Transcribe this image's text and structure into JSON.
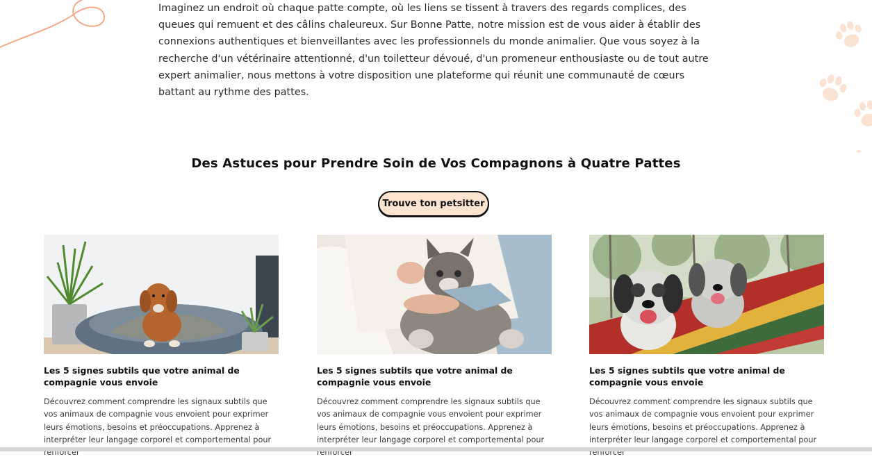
{
  "intro": {
    "text": "Imaginez un endroit où chaque patte compte, où les liens se tissent à travers des regards complices, des queues qui remuent et des câlins chaleureux. Sur Bonne Patte, notre mission est de vous aider à établir des connexions authentiques et bienveillantes avec les professionnels du monde animalier. Que vous soyez à la recherche d'un vétérinaire attentionné, d'un toiletteur dévoué, d'un promeneur enthousiaste ou de tout autre expert animalier, nous mettons à votre disposition une plateforme qui réunit une communauté de cœurs battant au rythme des pattes."
  },
  "tips": {
    "title": "Des Astuces pour Prendre Soin de Vos Compagnons à Quatre Pattes",
    "cta_label": "Trouve ton petsitter"
  },
  "cards": [
    {
      "title": "Les 5 signes subtils que votre animal de compagnie vous envoie",
      "excerpt": "Découvrez comment comprendre les signaux subtils que vos animaux de compagnie vous envoient pour exprimer leurs émotions, besoins et préoccupations. Apprenez à interpréter leur langage corporel et comportemental pour renforcer"
    },
    {
      "title": "Les 5 signes subtils que votre animal de compagnie vous envoie",
      "excerpt": "Découvrez comment comprendre les signaux subtils que vos animaux de compagnie vous envoient pour exprimer leurs émotions, besoins et préoccupations. Apprenez à interpréter leur langage corporel et comportemental pour renforcer"
    },
    {
      "title": "Les 5 signes subtils que votre animal de compagnie vous envoie",
      "excerpt": "Découvrez comment comprendre les signaux subtils que vos animaux de compagnie vous envoient pour exprimer leurs émotions, besoins et préoccupations. Apprenez à interpréter leur langage corporel et comportemental pour renforcer"
    }
  ],
  "colors": {
    "accent": "#f4a988",
    "cta_bg": "#fde4d0",
    "paw": "#fbe3d3"
  },
  "icons": [
    "squiggle-decoration",
    "paw-print-icon"
  ]
}
